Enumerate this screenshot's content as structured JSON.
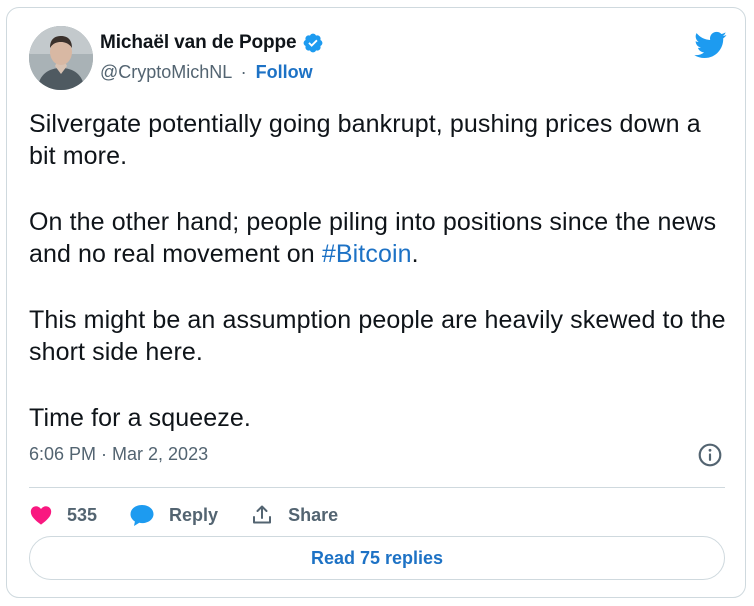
{
  "author": {
    "display_name": "Michaël van de Poppe",
    "handle": "@CryptoMichNL",
    "separator": "·",
    "follow_label": "Follow",
    "verified": true
  },
  "tweet": {
    "paragraphs": [
      {
        "text": "Silvergate potentially going bankrupt, pushing prices down a bit more."
      },
      {
        "text_before": "On the other hand; people piling into positions since the news and no real movement on ",
        "hashtag": "#Bitcoin",
        "text_after": "."
      },
      {
        "text": "This might be an assumption people are heavily skewed to the short side here."
      },
      {
        "text": "Time for a squeeze."
      }
    ],
    "timestamp": "6:06 PM · Mar 2, 2023"
  },
  "actions": {
    "likes_count": "535",
    "reply_label": "Reply",
    "share_label": "Share"
  },
  "read_replies_label": "Read 75 replies",
  "icons": {
    "brand": "twitter-bird-icon",
    "verified": "verified-badge-icon",
    "info": "info-icon",
    "like": "heart-icon",
    "reply": "speech-bubble-icon",
    "share": "share-upload-icon"
  },
  "colors": {
    "link_blue": "#1d72c5",
    "twitter_blue": "#1d9bf0",
    "like_pink": "#f91880",
    "text": "#0f1419",
    "secondary_text": "#536471",
    "border": "#cfd9de"
  }
}
